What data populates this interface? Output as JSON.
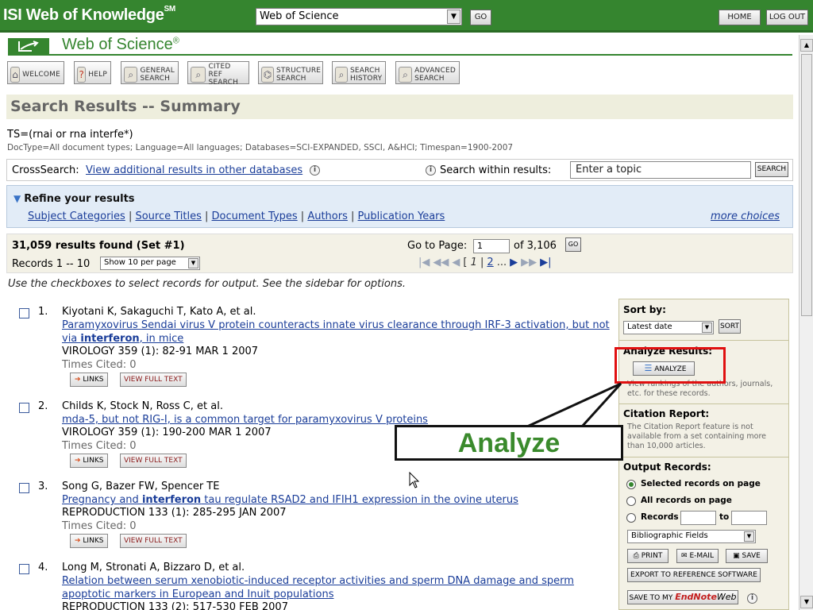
{
  "header": {
    "brand": "ISI Web of Knowledge",
    "brand_mark": "SM",
    "database_selected": "Web of Science",
    "go_label": "GO",
    "home_label": "HOME",
    "logout_label": "LOG OUT"
  },
  "product": {
    "title": "Web of Science",
    "mark": "®"
  },
  "nav": [
    {
      "label": "WELCOME",
      "icon": "home-icon",
      "glyph": "⌂"
    },
    {
      "label": "HELP",
      "icon": "help-icon",
      "glyph": "?"
    },
    {
      "label": "GENERAL SEARCH",
      "icon": "search-icon",
      "glyph": "⌕"
    },
    {
      "label": "CITED REF SEARCH",
      "icon": "cited-ref-icon",
      "glyph": "⌕"
    },
    {
      "label": "STRUCTURE SEARCH",
      "icon": "structure-icon",
      "glyph": "⌬"
    },
    {
      "label": "SEARCH HISTORY",
      "icon": "history-icon",
      "glyph": "⌕"
    },
    {
      "label": "ADVANCED SEARCH",
      "icon": "advanced-icon",
      "glyph": "⌕"
    }
  ],
  "page_title": "Search Results -- Summary",
  "query": {
    "text": "TS=(rnai or rna interfe*)",
    "meta": "DocType=All document types; Language=All languages; Databases=SCI-EXPANDED, SSCI, A&HCI; Timespan=1900-2007"
  },
  "crosssearch": {
    "label": "CrossSearch:",
    "link": "View additional results in other databases",
    "within_label": "Search within results:",
    "topic_placeholder": "Enter a topic",
    "search_label": "SEARCH"
  },
  "refine": {
    "title": "Refine your results",
    "links": [
      "Subject Categories",
      "Source Titles",
      "Document Types",
      "Authors",
      "Publication Years"
    ],
    "more": "more choices"
  },
  "results": {
    "found": "31,059 results found (Set #1)",
    "records_label": "Records 1 -- 10",
    "per_page": "Show 10 per page",
    "goto_label": "Go to Page:",
    "page_value": "1",
    "of_pages": "of 3,106",
    "go_label": "GO",
    "current_page": "1",
    "next_page": "2",
    "ellipsis": "..."
  },
  "hint": "Use the checkboxes to select records for output. See the sidebar for options.",
  "records": [
    {
      "num": "1.",
      "authors": "Kiyotani K, Sakaguchi T, Kato A, et al.",
      "title_pre": "Paramyxovirus Sendai virus V protein counteracts innate virus clearance through IRF-3 activation, but not via ",
      "title_bold": "interferon",
      "title_post": ", in mice",
      "source": "VIROLOGY 359 (1): 82-91 MAR 1 2007",
      "cited": "Times Cited: 0"
    },
    {
      "num": "2.",
      "authors": "Childs K, Stock N, Ross C, et al.",
      "title_pre": "mda-5, but not RIG-I, is a common target for paramyxovirus V proteins",
      "title_bold": "",
      "title_post": "",
      "source": "VIROLOGY 359 (1): 190-200 MAR 1 2007",
      "cited": "Times Cited: 0"
    },
    {
      "num": "3.",
      "authors": "Song G, Bazer FW, Spencer TE",
      "title_pre": "Pregnancy and ",
      "title_bold": "interferon",
      "title_post": " tau regulate RSAD2 and IFIH1 expression in the ovine uterus",
      "source": "REPRODUCTION 133 (1): 285-295 JAN 2007",
      "cited": "Times Cited: 0"
    },
    {
      "num": "4.",
      "authors": "Long M, Stronati A, Bizzaro D, et al.",
      "title_pre": "Relation between serum xenobiotic-induced receptor activities and sperm DNA damage and sperm apoptotic markers in European and Inuit populations",
      "title_bold": "",
      "title_post": "",
      "source": "REPRODUCTION 133 (2): 517-530 FEB 2007",
      "cited": ""
    }
  ],
  "record_buttons": {
    "links": "LINKS",
    "full_text": "VIEW FULL TEXT"
  },
  "sidebar": {
    "sort_title": "Sort by:",
    "sort_value": "Latest date",
    "sort_button": "SORT",
    "analyze_title": "Analyze Results:",
    "analyze_button": "ANALYZE",
    "analyze_note": "View rankings of the authors, journals, etc. for these records.",
    "citation_title": "Citation Report:",
    "citation_note": "The Citation Report feature is not available from a set containing more than 10,000 articles.",
    "output_title": "Output Records:",
    "opt_selected": "Selected records on page",
    "opt_all": "All records on page",
    "opt_records": "Records",
    "to_label": "to",
    "fields_value": "Bibliographic Fields",
    "print": "PRINT",
    "email": "E-MAIL",
    "save": "SAVE",
    "export": "EXPORT TO REFERENCE SOFTWARE",
    "save_endnote_prefix": "SAVE TO MY",
    "save_endnote_brand": "EndNote",
    "save_endnote_suffix": "Web"
  },
  "callout": {
    "label": "Analyze"
  }
}
